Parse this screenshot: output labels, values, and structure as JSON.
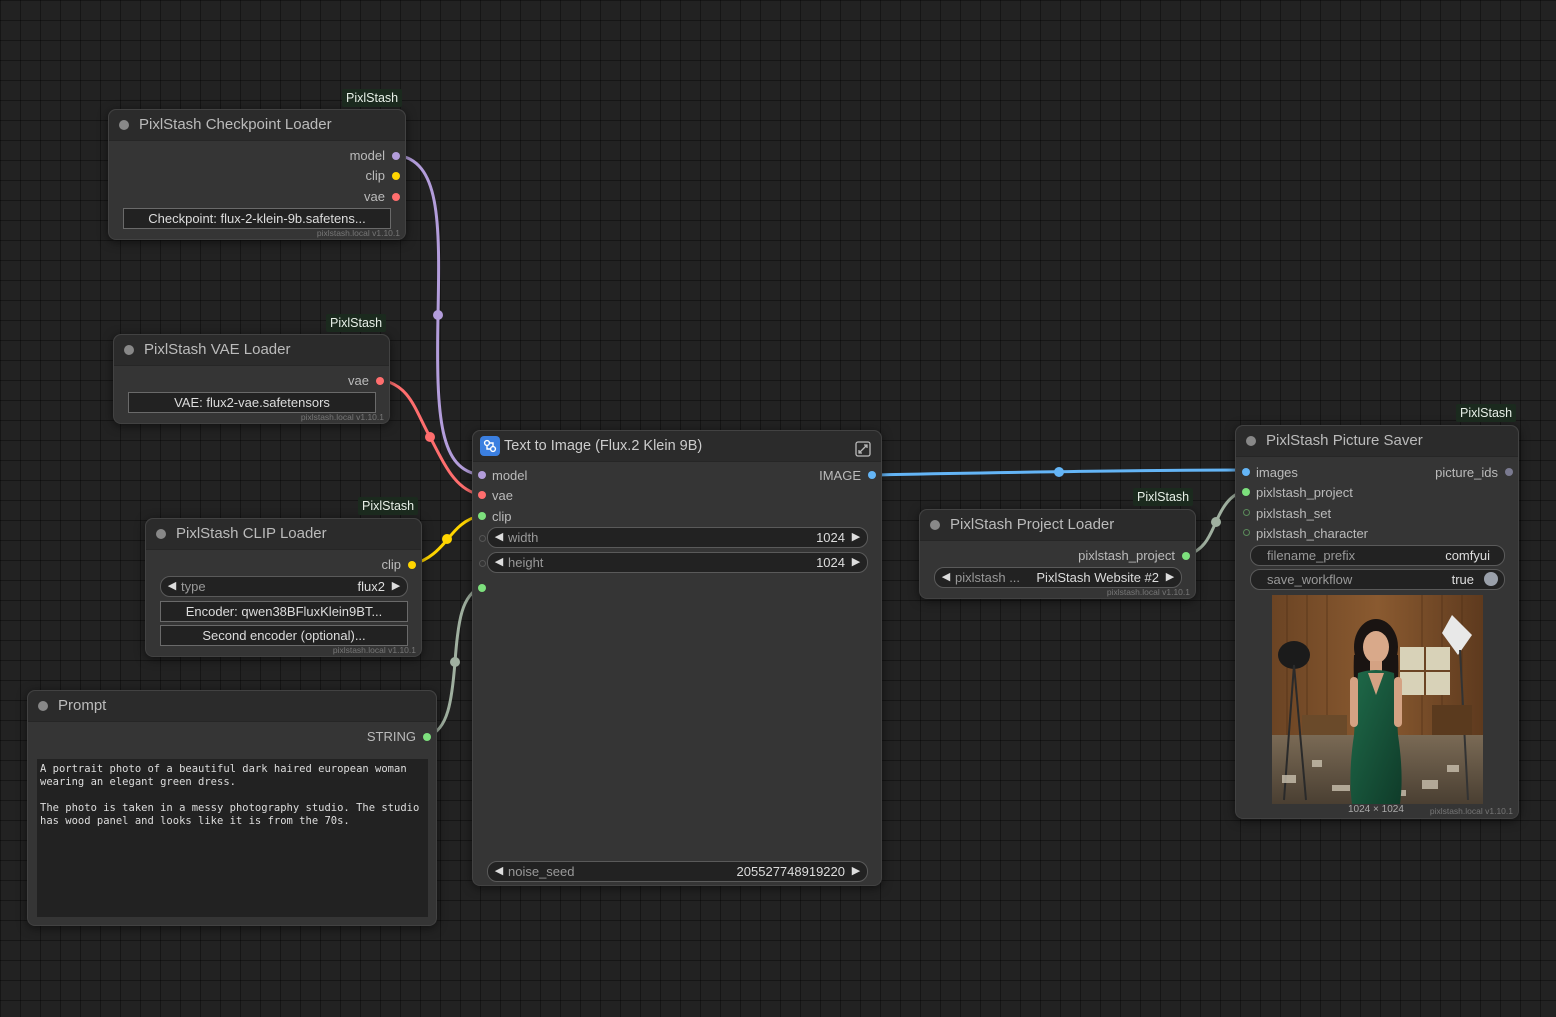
{
  "badge_label": "PixlStash",
  "footer_text": "pixlstash.local  v1.10.1",
  "colors": {
    "model": "#b39ddb",
    "clip": "#ffd500",
    "vae": "#ff6e6e",
    "image": "#64b5f6",
    "string": "#7de07d",
    "generic": "#a0b0a0"
  },
  "checkpoint_loader": {
    "title": "PixlStash Checkpoint Loader",
    "outputs": [
      "model",
      "clip",
      "vae"
    ],
    "checkpoint_button": "Checkpoint: flux-2-klein-9b.safetens..."
  },
  "vae_loader": {
    "title": "PixlStash VAE Loader",
    "output": "vae",
    "vae_button": "VAE: flux2-vae.safetensors"
  },
  "clip_loader": {
    "title": "PixlStash CLIP Loader",
    "output": "clip",
    "type_label": "type",
    "type_value": "flux2",
    "encoder_button": "Encoder: qwen38BFluxKlein9BT...",
    "second_encoder_button": "Second encoder (optional)..."
  },
  "prompt_node": {
    "title": "Prompt",
    "output": "STRING",
    "text": "A portrait photo of a beautiful dark haired european woman\nwearing an elegant green dress.\n\nThe photo is taken in a messy photography studio. The studio\nhas wood panel and looks like it is from the 70s."
  },
  "text_to_image": {
    "title": "Text to Image (Flux.2 Klein 9B)",
    "inputs": [
      "model",
      "vae",
      "clip"
    ],
    "output": "IMAGE",
    "width_label": "width",
    "width_value": "1024",
    "height_label": "height",
    "height_value": "1024",
    "seed_label": "noise_seed",
    "seed_value": "205527748919220"
  },
  "project_loader": {
    "title": "PixlStash Project Loader",
    "output": "pixlstash_project",
    "combo_label": "pixlstash ...",
    "combo_value": "PixlStash Website #2"
  },
  "picture_saver": {
    "title": "PixlStash Picture Saver",
    "inputs": [
      "images",
      "pixlstash_project",
      "pixlstash_set",
      "pixlstash_character"
    ],
    "output": "picture_ids",
    "filename_prefix_label": "filename_prefix",
    "filename_prefix_value": "comfyui",
    "save_workflow_label": "save_workflow",
    "save_workflow_value": "true",
    "image_size": "1024 × 1024"
  }
}
